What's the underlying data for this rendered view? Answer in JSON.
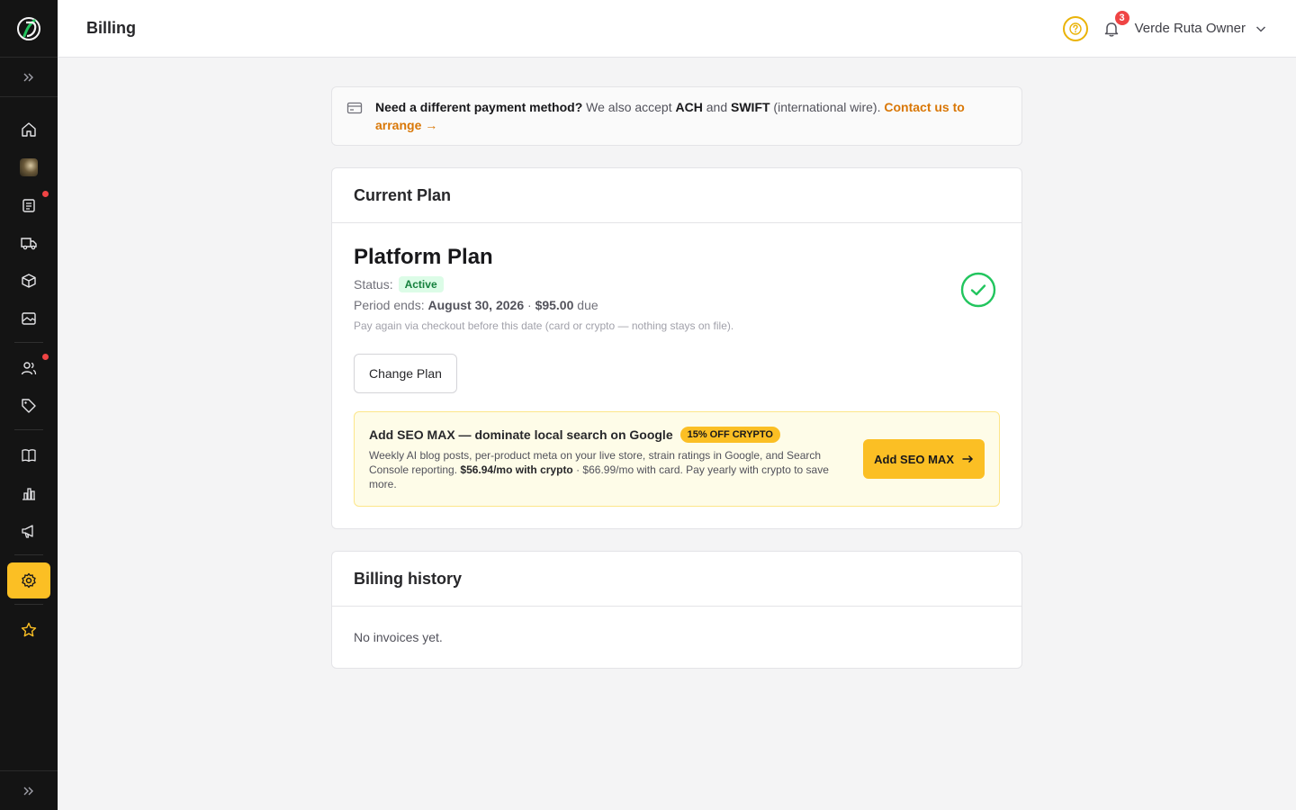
{
  "header": {
    "title": "Billing",
    "notification_count": "3",
    "user_name": "Verde Ruta Owner"
  },
  "notice": {
    "lead": "Need a different payment method?",
    "text_1": " We also accept ",
    "method_1": "ACH",
    "text_2": " and ",
    "method_2": "SWIFT",
    "text_3": " (international wire). ",
    "link": "Contact us to arrange →"
  },
  "current_plan": {
    "heading": "Current Plan",
    "plan_name": "Platform Plan",
    "status_label": "Status:",
    "status_value": "Active",
    "period_label": "Period ends:",
    "period_date": "August 30, 2026",
    "period_sep": " · ",
    "period_amount": "$95.00",
    "period_suffix": " due",
    "pay_note": "Pay again via checkout before this date (card or crypto — nothing stays on file).",
    "change_button": "Change Plan"
  },
  "promo": {
    "title": "Add SEO MAX — dominate local search on Google",
    "badge": "15% OFF CRYPTO",
    "desc_1": "Weekly AI blog posts, per-product meta on your live store, strain ratings in Google, and Search Console reporting. ",
    "desc_price_crypto": "$56.94/mo with crypto",
    "desc_2": " · $66.99/mo with card. Pay yearly with crypto to save more.",
    "button": "Add SEO MAX"
  },
  "billing_history": {
    "heading": "Billing history",
    "empty": "No invoices yet."
  },
  "colors": {
    "accent": "#fbbf24",
    "sidebar_bg": "#141414",
    "success": "#22c55e",
    "link": "#d97706",
    "alert": "#ef4444"
  },
  "sidebar": {
    "icons": [
      "home-icon",
      "store-avatar",
      "orders-icon",
      "delivery-icon",
      "products-icon",
      "media-icon",
      "customers-icon",
      "tags-icon",
      "catalog-icon",
      "analytics-icon",
      "marketing-icon",
      "settings-icon",
      "favorites-icon"
    ]
  }
}
